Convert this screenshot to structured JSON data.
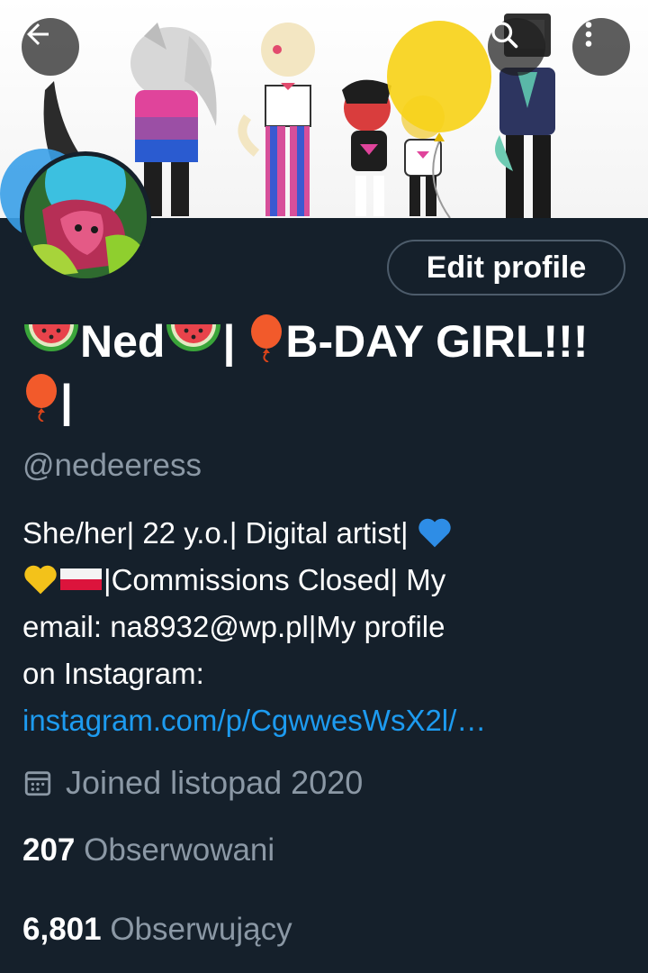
{
  "profile": {
    "edit_label": "Edit profile",
    "name_part1": "Ned",
    "name_part2": "| ",
    "name_part3": "B-DAY GIRL!!! ",
    "name_part4": "|",
    "handle": "@nedeeress",
    "bio_line1": "She/her| 22 y.o.| Digital artist| ",
    "bio_line2": "|Commissions Closed| My",
    "bio_line3": "email: na8932@wp.pl|My profile",
    "bio_line4": "on Instagram: ",
    "bio_link": "instagram.com/p/CgwwesWsX2l/…",
    "joined": "Joined listopad 2020",
    "following_count": "207",
    "following_label": "Obserwowani",
    "followers_count": "6,801",
    "followers_label": "Obserwujący"
  },
  "icons": {
    "back": "arrow-left",
    "search": "magnifier",
    "more": "vertical-dots",
    "calendar": "calendar",
    "watermelon": "watermelon-emoji",
    "balloon": "red-balloon-emoji",
    "blue_heart": "blue-heart-emoji",
    "yellow_heart": "yellow-heart-emoji",
    "flag": "poland-flag-emoji"
  },
  "colors": {
    "background": "#15202b",
    "link": "#1d9bf0",
    "secondary_text": "#8b98a5",
    "button_border": "#4d5c6b"
  }
}
